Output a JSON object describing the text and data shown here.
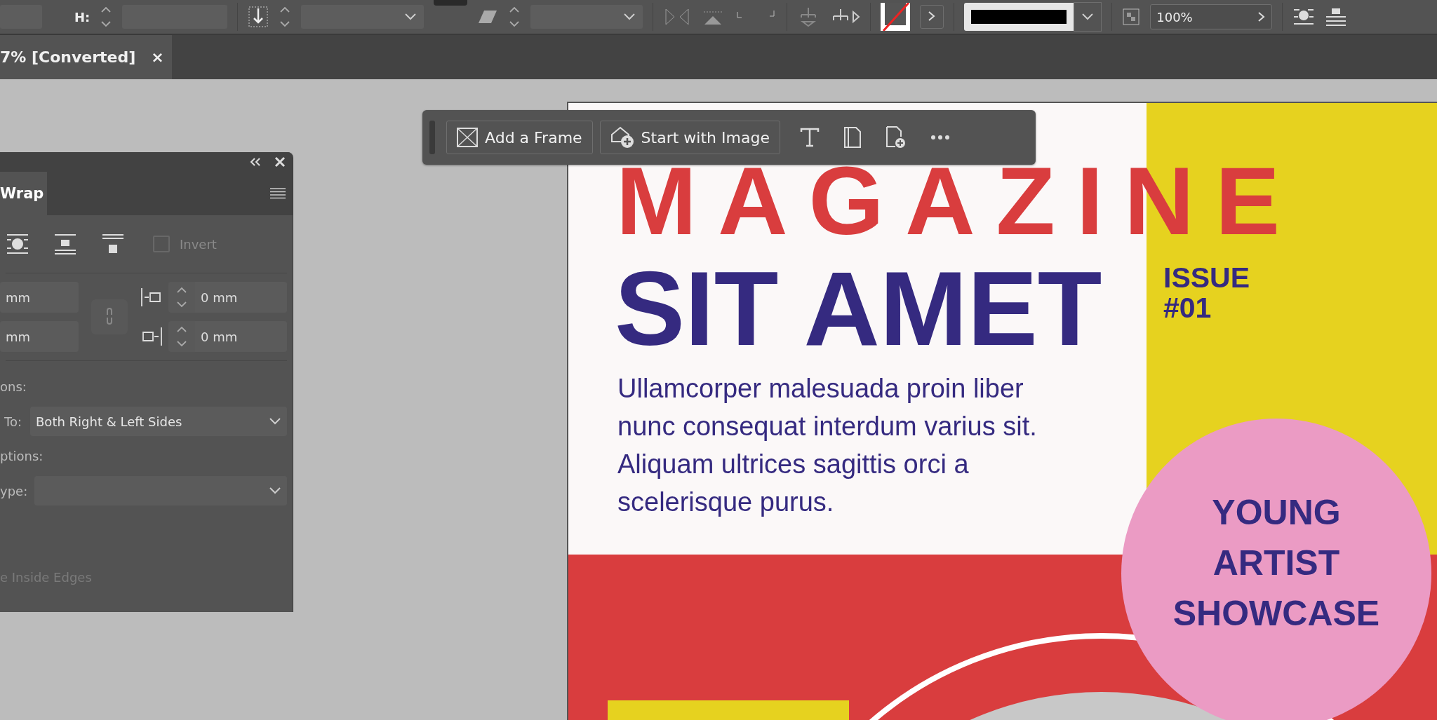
{
  "control_bar": {
    "h_label": "H:",
    "opacity": "100%"
  },
  "document_tab": {
    "title": "7% [Converted]",
    "close": "×",
    "selected": true
  },
  "text_wrap_panel": {
    "tab": "Wrap",
    "invert": {
      "label": "Invert",
      "checked": false,
      "disabled": true
    },
    "offsets": [
      {
        "value": "mm"
      },
      {
        "value": "0 mm"
      },
      {
        "value": "mm"
      },
      {
        "value": "0 mm"
      }
    ],
    "wrap_options_label": "ons:",
    "wrap_to_label": "To:",
    "wrap_to_value": "Both Right & Left Sides",
    "contour_options_label": "ptions:",
    "type_label": "ype:",
    "inside_edges": {
      "label": "e Inside Edges",
      "disabled": true
    }
  },
  "floating_toolbar": {
    "buttons": [
      {
        "kind": "frame",
        "label": "Add a Frame"
      },
      {
        "kind": "image",
        "label": "Start with Image"
      }
    ]
  },
  "page": {
    "title": "MAGAZINE",
    "subtitle": "SIT AMET",
    "issue": "ISSUE #01",
    "body": "Ullamcorper malesuada proin liber nunc consequat interdum varius sit. Aliquam ultrices sagittis orci a scelerisque purus.",
    "badge": "YOUNG ARTIST SHOWCASE"
  }
}
